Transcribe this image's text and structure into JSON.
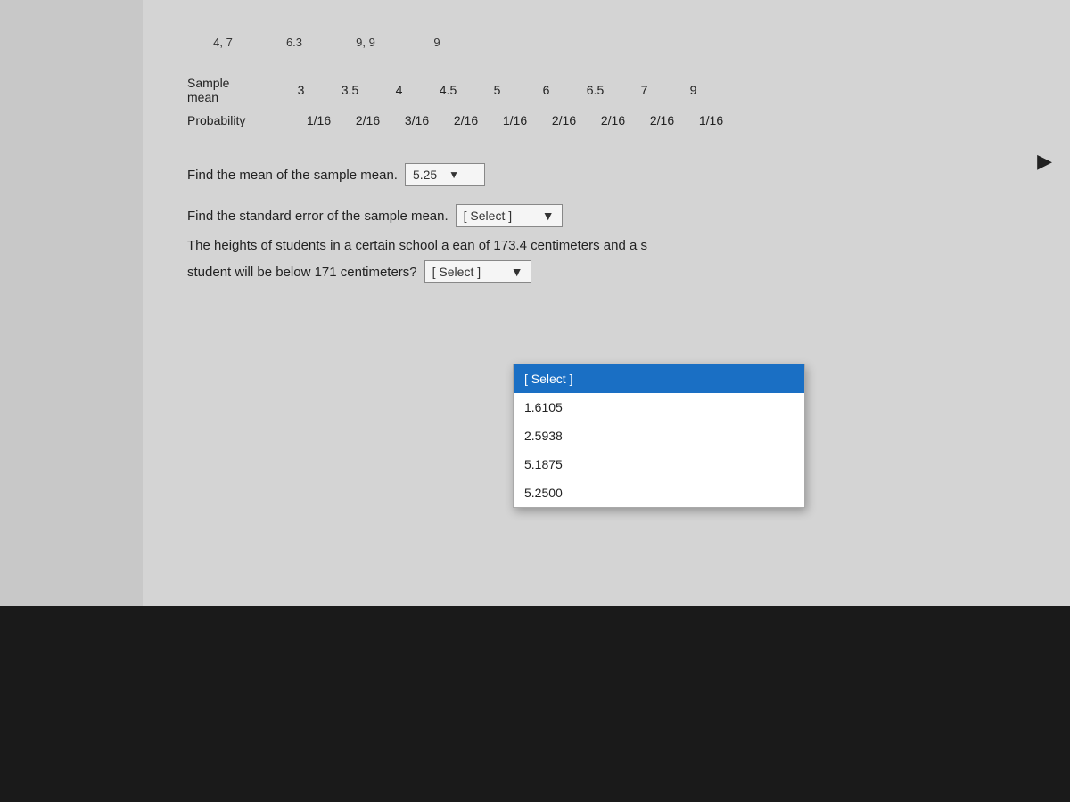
{
  "page": {
    "background_top": "#d4d4d4",
    "background_bottom": "#1a1a1a"
  },
  "truncated_row": {
    "col1": "4, 7",
    "col2": "6.3",
    "col3": "9, 9",
    "col4": "9"
  },
  "sample_mean": {
    "label_line1": "Sample",
    "label_line2": "mean",
    "values": [
      "3",
      "3.5",
      "4",
      "4.5",
      "5",
      "6",
      "6.5",
      "7",
      "9"
    ]
  },
  "probability": {
    "label": "Probability",
    "values": [
      "1/16",
      "2/16",
      "3/16",
      "2/16",
      "1/16",
      "2/16",
      "2/16",
      "2/16",
      "1/16"
    ]
  },
  "find_mean": {
    "question": "Find the mean of the sample mean.",
    "value": "5.25",
    "chevron": "▼"
  },
  "find_std_error": {
    "question": "Find the standard error of the sample mean.",
    "placeholder": "[ Select ]",
    "chevron": "▼"
  },
  "dropdown": {
    "items": [
      {
        "label": "[ Select ]",
        "selected": true
      },
      {
        "label": "1.6105",
        "selected": false
      },
      {
        "label": "2.5938",
        "selected": false
      },
      {
        "label": "5.1875",
        "selected": false
      },
      {
        "label": "5.2500",
        "selected": false
      }
    ]
  },
  "heights_question": {
    "text_before": "The heights of students in a certain school a",
    "text_after": "ean of 173.4 centimeters and a s"
  },
  "student_question": {
    "text": "student will be below 171 centimeters?",
    "placeholder": "[ Select ]"
  }
}
